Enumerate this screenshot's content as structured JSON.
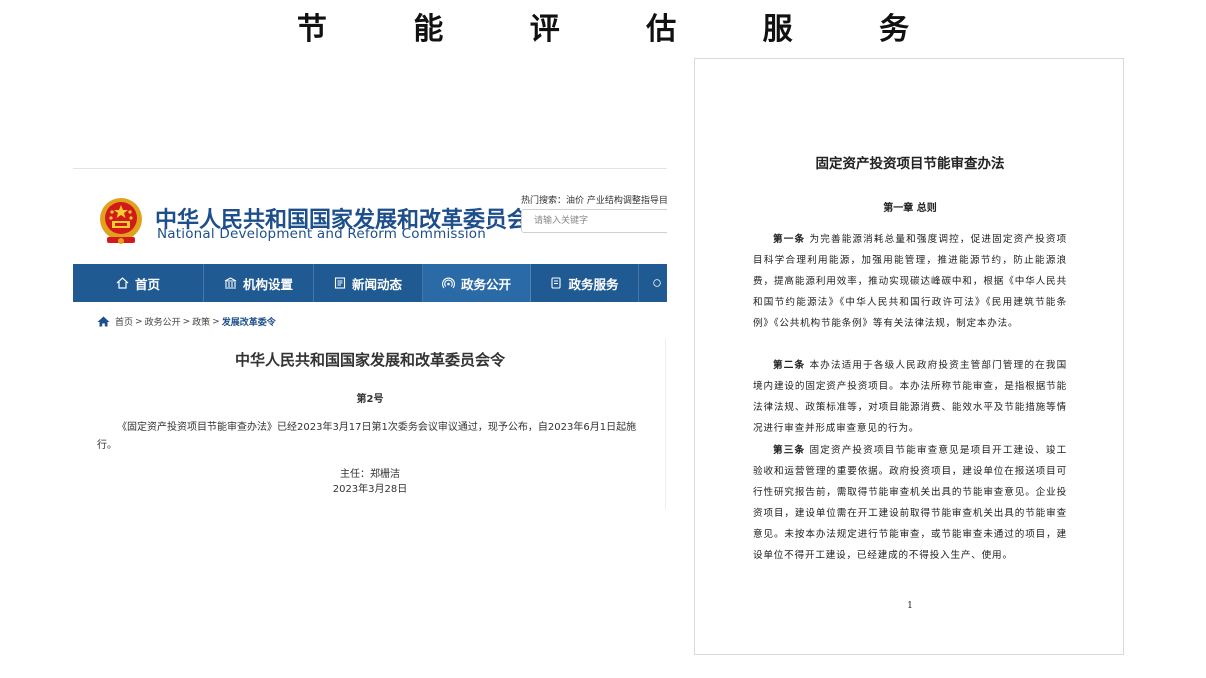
{
  "slide_title": "节 能 评 估 服 务",
  "site": {
    "brand_cn": "中华人民共和国国家发展和改革委员会",
    "brand_en": "National Development and Reform Commission",
    "hot_search": "热门搜索：油价  产业结构调整指导目",
    "search_placeholder": "请输入关键字",
    "nav": [
      {
        "label": "首页",
        "icon": "home-icon"
      },
      {
        "label": "机构设置",
        "icon": "institution-icon"
      },
      {
        "label": "新闻动态",
        "icon": "news-icon"
      },
      {
        "label": "政务公开",
        "icon": "broadcast-icon"
      },
      {
        "label": "政务服务",
        "icon": "document-icon"
      }
    ],
    "breadcrumb": {
      "home": "首页",
      "items": [
        "政务公开",
        "政策"
      ],
      "current": "发展改革委令",
      "separator": ">"
    },
    "order_title": "中华人民共和国国家发展和改革委员会令",
    "order_no": "第2号",
    "order_body": "《固定资产投资项目节能审查办法》已经2023年3月17日第1次委务会议审议通过，现予公布，自2023年6月1日起施行。",
    "signer": "主任：郑栅洁",
    "date": "2023年3月28日",
    "colors": {
      "nav_bg": "#1f5a92",
      "brand": "#1d4f8c"
    }
  },
  "doc": {
    "title": "固定资产投资项目节能审查办法",
    "chapter": "第一章   总则",
    "articles": [
      {
        "label": "第一条",
        "text": "为完善能源消耗总量和强度调控，促进固定资产投资项目科学合理利用能源，加强用能管理，推进能源节约，防止能源浪费，提高能源利用效率，推动实现碳达峰碳中和，根据《中华人民共和国节约能源法》《中华人民共和国行政许可法》《民用建筑节能条例》《公共机构节能条例》等有关法律法规，制定本办法。"
      },
      {
        "label": "第二条",
        "text": "本办法适用于各级人民政府投资主管部门管理的在我国境内建设的固定资产投资项目。本办法所称节能审查，是指根据节能法律法规、政策标准等，对项目能源消费、能效水平及节能措施等情况进行审查并形成审查意见的行为。"
      },
      {
        "label": "第三条",
        "text": "固定资产投资项目节能审查意见是项目开工建设、竣工验收和运营管理的重要依据。政府投资项目，建设单位在报送项目可行性研究报告前，需取得节能审查机关出具的节能审查意见。企业投资项目，建设单位需在开工建设前取得节能审查机关出具的节能审查意见。未按本办法规定进行节能审查，或节能审查未通过的项目，建设单位不得开工建设，已经建成的不得投入生产、使用。"
      }
    ],
    "page_number": "1"
  }
}
